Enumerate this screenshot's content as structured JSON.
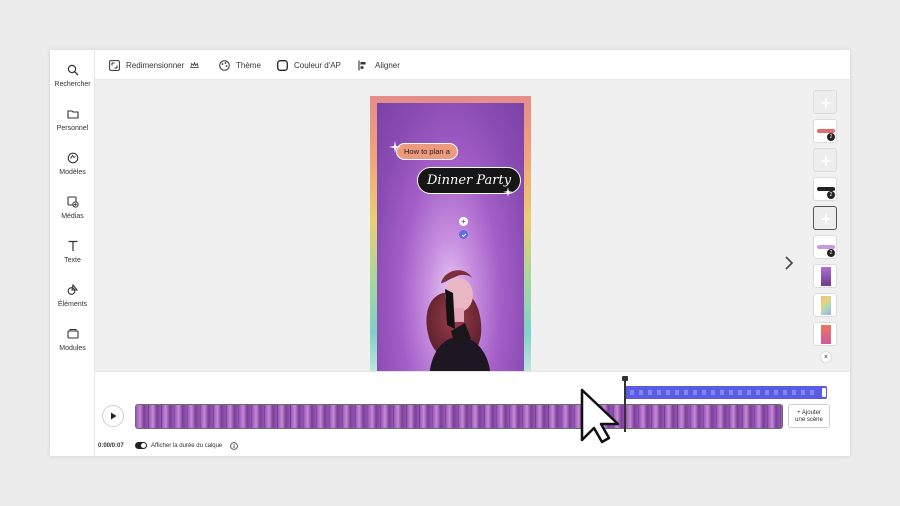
{
  "rail": {
    "items": [
      {
        "label": "Rechercher",
        "icon": "search-icon"
      },
      {
        "label": "Personnel",
        "icon": "folder-icon"
      },
      {
        "label": "Modèles",
        "icon": "templates-icon"
      },
      {
        "label": "Médias",
        "icon": "media-icon"
      },
      {
        "label": "Texte",
        "icon": "text-icon"
      },
      {
        "label": "Éléments",
        "icon": "elements-icon"
      },
      {
        "label": "Modules",
        "icon": "modules-icon"
      }
    ]
  },
  "toolbar": {
    "resize_label": "Redimensionner",
    "theme_label": "Thème",
    "bg_color_label": "Couleur d'AP",
    "align_label": "Aligner"
  },
  "canvas": {
    "pill_small": "How to plan a",
    "pill_big": "Dinner Party"
  },
  "scenes": {
    "badges": [
      "2",
      "2",
      "2"
    ],
    "close": "×"
  },
  "timeline": {
    "add_scene_line1": "+ Ajouter",
    "add_scene_line2": "une scène",
    "time": "0:00/0:07",
    "toggle_label": "Afficher la durée du calque",
    "layer_duration_shown": true
  },
  "colors": {
    "accent": "#5a5ce6",
    "canvas_purple": "#a35fc7"
  }
}
